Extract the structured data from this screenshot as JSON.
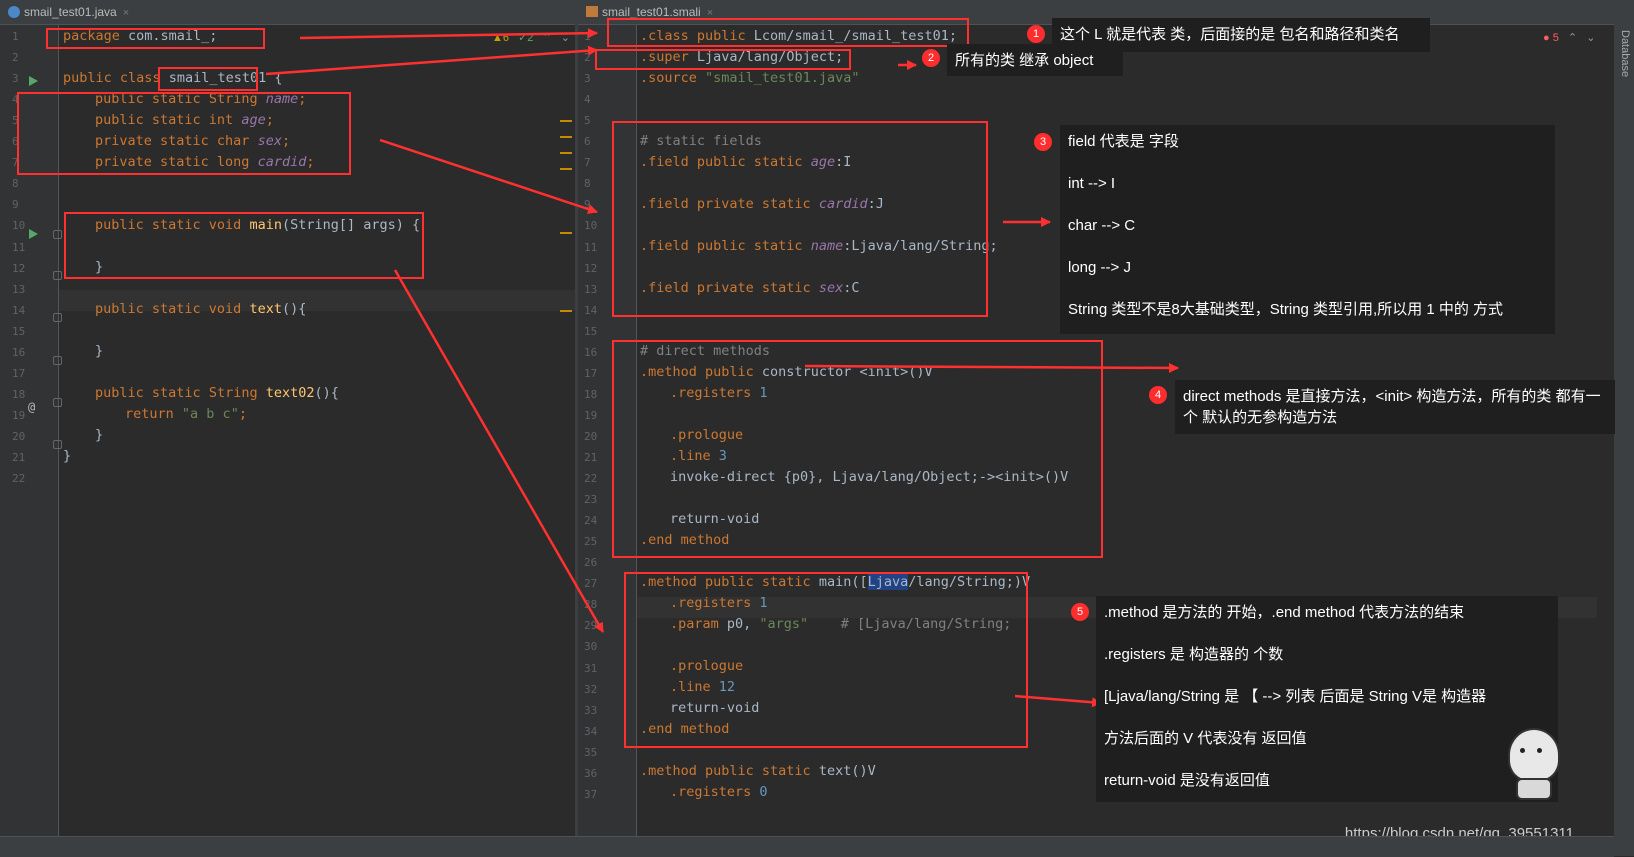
{
  "left_tab": {
    "title": "smail_test01.java",
    "close": "×"
  },
  "right_tab": {
    "title": "smail_test01.smali",
    "close": "×"
  },
  "left_status": {
    "warnings": "6",
    "checks": "2"
  },
  "right_status": {
    "errors": "5"
  },
  "side_panel": {
    "label": "Database"
  },
  "watermark": "https://blog.csdn.net/qq_39551311",
  "left_line_numbers": [
    "1",
    "2",
    "3",
    "4",
    "5",
    "6",
    "7",
    "8",
    "9",
    "10",
    "11",
    "12",
    "13",
    "14",
    "15",
    "16",
    "17",
    "18",
    "19",
    "20",
    "21",
    "22"
  ],
  "right_line_numbers": [
    "1",
    "2",
    "3",
    "4",
    "5",
    "6",
    "7",
    "8",
    "9",
    "10",
    "11",
    "12",
    "13",
    "14",
    "15",
    "16",
    "17",
    "18",
    "19",
    "20",
    "21",
    "22",
    "23",
    "24",
    "25",
    "26",
    "27",
    "28",
    "29",
    "30",
    "31",
    "32",
    "33",
    "34",
    "35",
    "36",
    "37"
  ],
  "java_lines": {
    "l1": {
      "kw": "package",
      "rest": " com.smail_;"
    },
    "l3": {
      "kw": "public class",
      "name": "smail_test01",
      "rest": " {"
    },
    "l4": {
      "kw": "public static",
      "type": "String",
      "field": "name",
      "end": ";"
    },
    "l5": {
      "kw": "public static int",
      "field": "age",
      "end": ";"
    },
    "l6": {
      "kw": "private static char",
      "field": "sex",
      "end": ";"
    },
    "l7": {
      "kw": "private static long",
      "field": "cardid",
      "end": ";"
    },
    "l10": {
      "kw": "public static void",
      "fn": "main",
      "rest": "(String[] args) {"
    },
    "l12": {
      "rest": "}"
    },
    "l14": {
      "kw": "public static void",
      "fn": "text",
      "rest": "(){"
    },
    "l16": {
      "rest": "}"
    },
    "l18": {
      "kw": "public static",
      "type": "String",
      "fn": "text02",
      "rest": "(){"
    },
    "l19": {
      "kw": "return",
      "str": "\"a b c\"",
      "end": ";"
    },
    "l20": {
      "rest": "}"
    },
    "l21": {
      "rest": "}"
    }
  },
  "smali_lines": {
    "l1": {
      "kw": ".class public",
      "rest": " Lcom/smail_/smail_test01;"
    },
    "l2": {
      "kw": ".super",
      "rest": " Ljava/lang/Object;"
    },
    "l3": {
      "kw": ".source",
      "str": " \"smail_test01.java\""
    },
    "l6": "# static fields",
    "l7": {
      "kw": ".field public static",
      "field": "age",
      "rest": ":I"
    },
    "l9": {
      "kw": ".field private static",
      "field": "cardid",
      "rest": ":J"
    },
    "l11": {
      "kw": ".field public static",
      "field": "name",
      "rest": ":Ljava/lang/String;"
    },
    "l13": {
      "kw": ".field private static",
      "field": "sex",
      "rest": ":C"
    },
    "l16": "# direct methods",
    "l17": {
      "kw": ".method public",
      "rest": " constructor <init>()V"
    },
    "l18": {
      "kw": ".registers",
      "num": " 1"
    },
    "l20": {
      "kw": ".prologue"
    },
    "l21": {
      "kw": ".line",
      "num": " 3"
    },
    "l22": {
      "rest": "invoke-direct {p0}, Ljava/lang/Object;-><init>()V"
    },
    "l24": {
      "rest": "return-void"
    },
    "l25": {
      "kw": ".end method"
    },
    "l27": {
      "kw": ".method public static",
      "rest_a": " main([",
      "hl": "Ljava",
      "rest_b": "/lang/String;)V"
    },
    "l28": {
      "kw": ".registers",
      "num": " 1"
    },
    "l29": {
      "kw": ".param",
      "rest": " p0, ",
      "str": "\"args\"",
      "cm": "    # [Ljava/lang/String;"
    },
    "l31": {
      "kw": ".prologue"
    },
    "l32": {
      "kw": ".line",
      "num": " 12"
    },
    "l33": {
      "rest": "return-void"
    },
    "l34": {
      "kw": ".end method"
    },
    "l36": {
      "kw": ".method public static",
      "rest": " text()V"
    },
    "l37": {
      "kw": ".registers",
      "num": " 0"
    }
  },
  "notes": {
    "n1": {
      "badge": "1",
      "text": "这个 L 就是代表 类，后面接的是 包名和路径和类名"
    },
    "n2": {
      "badge": "2",
      "text": "所有的类 继承 object"
    },
    "n3": {
      "badge": "3",
      "lines": [
        "field 代表是 字段",
        "int  -->  I",
        "char  --> C",
        "long  --> J",
        "String 类型不是8大基础类型，String 类型引用,所以用 1 中的 方式"
      ]
    },
    "n4": {
      "badge": "4",
      "text": "direct methods 是直接方法，<init> 构造方法，所有的类 都有一个 默认的无参构造方法"
    },
    "n5": {
      "badge": "5",
      "lines": [
        ".method 是方法的 开始，.end method  代表方法的结束",
        ".registers 是 构造器的 个数",
        "[Ljava/lang/String 是 【 --> 列表   后面是 String V是 构造器",
        "方法后面的 V 代表没有 返回值",
        "return-void 是没有返回值"
      ]
    }
  }
}
